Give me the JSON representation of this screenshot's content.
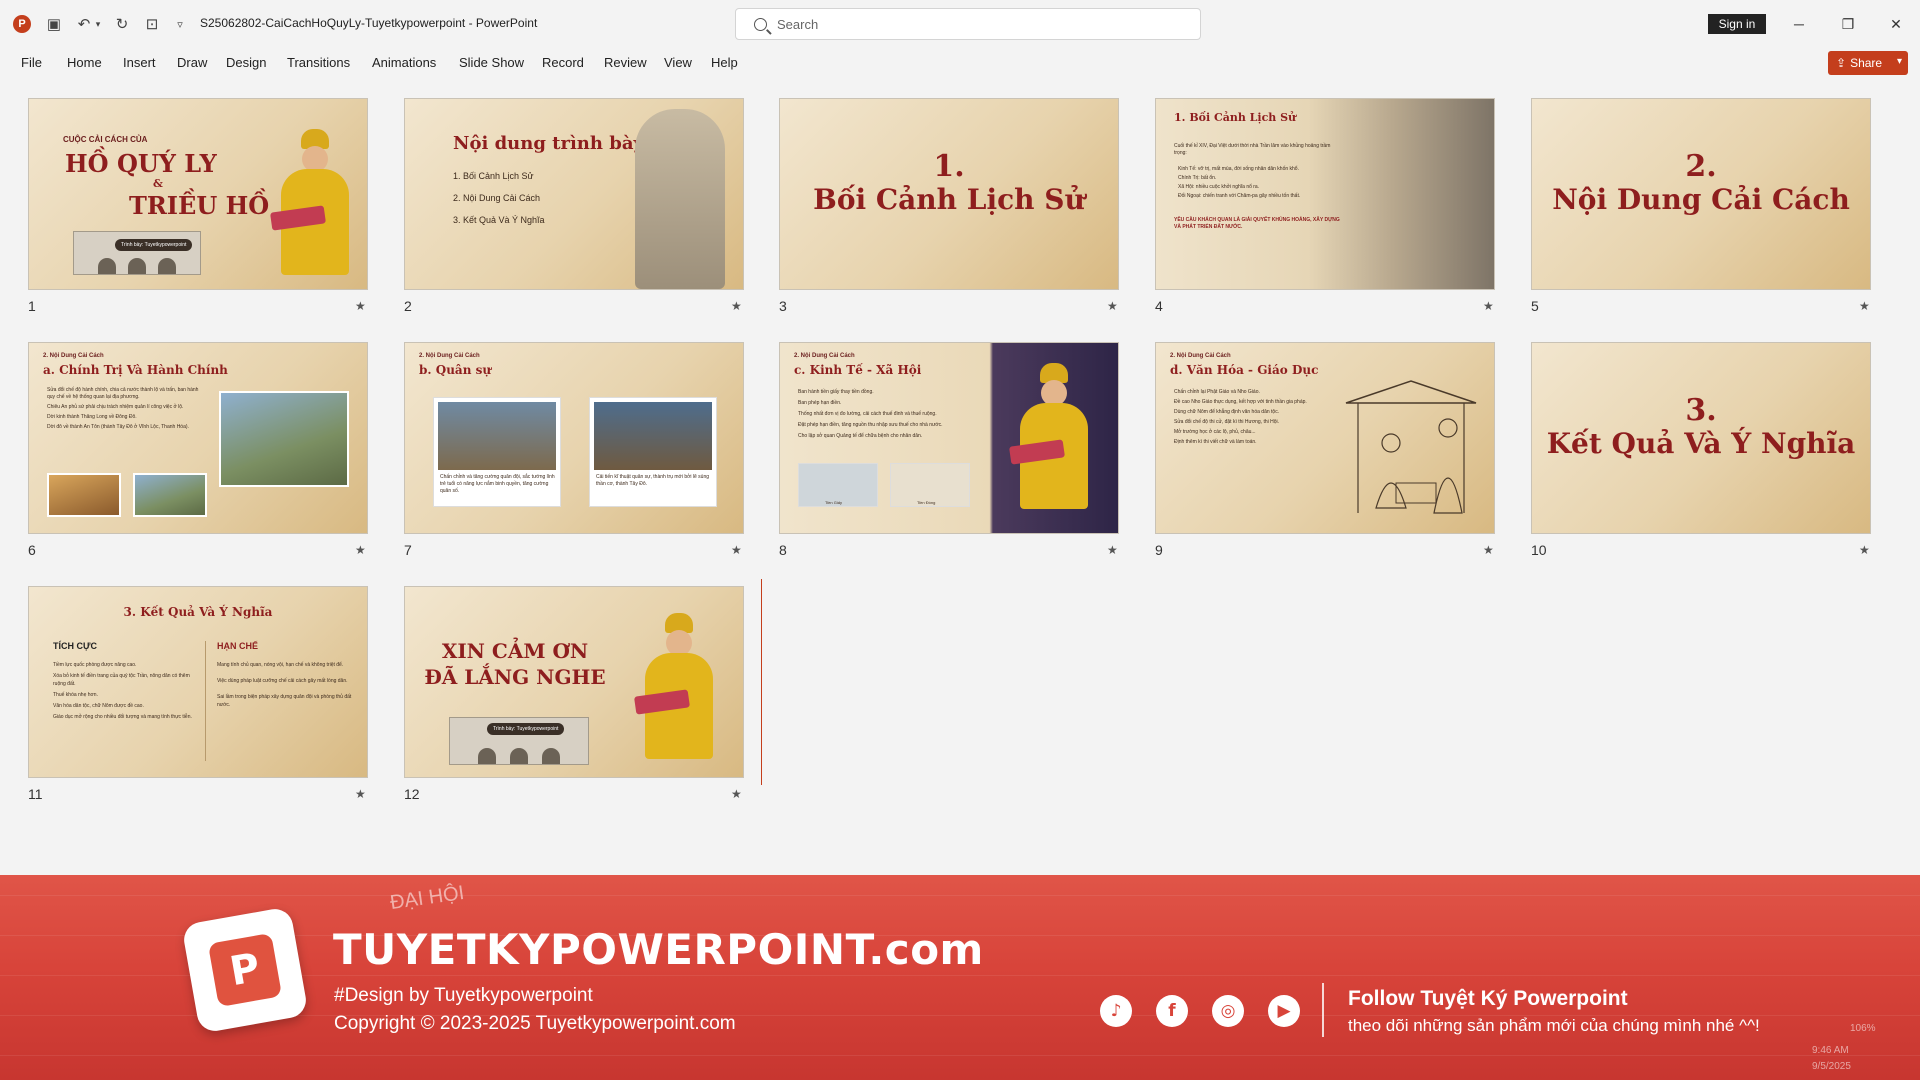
{
  "titlebar": {
    "doc_title": "S25062802-CaiCachHoQuyLy-Tuyetkypowerpoint  -  PowerPoint",
    "search_placeholder": "Search",
    "sign_in": "Sign in",
    "app_logo": "P"
  },
  "menu": [
    "File",
    "Home",
    "Insert",
    "Draw",
    "Design",
    "Transitions",
    "Animations",
    "Slide Show",
    "Record",
    "Review",
    "View",
    "Help"
  ],
  "share_label": "Share",
  "slides": [
    {
      "num": "1",
      "kicker": "CUỘC CẢI CÁCH CỦA",
      "title_a": "HỒ QUÝ LY",
      "amp": "&",
      "title_b": "TRIỀU HỒ",
      "tag": "Trình bày: Tuyetkypowerpoint"
    },
    {
      "num": "2",
      "title": "Nội dung trình bày",
      "items": [
        "1. Bối Cảnh Lịch Sử",
        "2. Nội Dung Cải Cách",
        "3. Kết Quả Và Ý Nghĩa"
      ]
    },
    {
      "num": "3",
      "line1": "1.",
      "line2": "Bối Cảnh Lịch Sử"
    },
    {
      "num": "4",
      "title": "1. Bối Cảnh Lịch Sử",
      "intro": "Cuối thế kỉ XIV, Đại Việt dưới thời nhà Trần lâm vào khủng hoảng trầm trọng:",
      "bullets": [
        "Kinh Tế: vỡ trị, mất mùa, đời sống nhân dân khốn khổ.",
        "Chính Trị: bất ổn.",
        "Xã Hội: nhiều cuộc khởi nghĩa nổ ra.",
        "Đối Ngoại: chiến tranh với Chăm-pa gây nhiều tốn thất."
      ],
      "note": "YÊU CẦU KHÁCH QUAN LÀ GIẢI QUYẾT KHỦNG HOẢNG, XÂY DỰNG VÀ PHÁT TRIỂN ĐẤT NƯỚC."
    },
    {
      "num": "5",
      "line1": "2.",
      "line2": "Nội Dung Cải Cách"
    },
    {
      "num": "6",
      "kicker": "2. Nội Dung Cải Cách",
      "title": "a. Chính Trị Và Hành Chính",
      "bullets": [
        "Sửa đổi chế độ hành chính, chia cả nước thành lộ và trấn, ban hành quy chế về hệ thống quan lại địa phương.",
        "Chiêu An phủ sứ phải chịu trách nhiệm quản lí công việc ở lộ.",
        "Dời kinh thành Thăng Long về Đông Đô.",
        "Dời đô về thành An Tôn (thành Tây Đô ở Vĩnh Lộc, Thanh Hóa)."
      ]
    },
    {
      "num": "7",
      "kicker": "2. Nội Dung Cải Cách",
      "title": "b. Quân sự",
      "cap1": "Chấn chỉnh và tăng cường quân đội, sắc tướng lính trẻ tuổi có năng lực nắm binh quyền, tăng cường quân số.",
      "cap2": "Cải tiến kĩ thuật quân sự, thành trụ mới bởi lẽ súng thần cơ, thành Tây Đô."
    },
    {
      "num": "8",
      "kicker": "2. Nội Dung Cải Cách",
      "title": "c. Kinh Tế - Xã Hội",
      "bullets": [
        "Ban hành tiền giấy thay tiền đồng.",
        "Ban phép hạn điền.",
        "Thống nhất đơn vị đo lường, cải cách thuế đinh và thuế ruộng.",
        "Đặt phép hạn điền, tăng nguồn thu nhập sưu thuế cho nhà nước.",
        "Cho lập sở quan Quảng tế để chữa bệnh cho nhân dân."
      ],
      "lbl1": "Tiền Giấy",
      "lbl2": "Tiền Đồng"
    },
    {
      "num": "9",
      "kicker": "2. Nội Dung Cải Cách",
      "title": "d. Văn Hóa - Giáo Dục",
      "bullets": [
        "Chấn chỉnh lại Phật Giáo và Nho Giáo.",
        "Đề cao Nho Giáo thực dụng, kết hợp với tinh thần gia pháp.",
        "Dùng chữ Nôm để khẳng định văn hóa dân tộc.",
        "Sửa đổi chế độ thi cử, đặt kì thi Hương, thi Hội.",
        "Mở trường học ở các lộ, phủ, châu...",
        "Định thêm kì thi viết chữ và làm toán."
      ]
    },
    {
      "num": "10",
      "line1": "3.",
      "line2": "Kết Quả Và Ý Nghĩa"
    },
    {
      "num": "11",
      "title": "3. Kết Quả Và Ý Nghĩa",
      "col1": "TÍCH CỰC",
      "col2": "HẠN CHẾ",
      "pos": [
        "Tiềm lực quốc phòng được nâng cao.",
        "Xóa bỏ kinh tế điền trang của quý tộc Trần, nông dân có thêm ruộng đất.",
        "Thuế khóa nhẹ hơn.",
        "Văn hóa dân tộc, chữ Nôm được đề cao.",
        "Giáo dục mở rộng cho nhiều đối tượng và mang tính thực tiễn."
      ],
      "neg": [
        "Mang tính chủ quan, nóng vội, hạn chế và không triệt để.",
        "Việc dùng pháp luật cưỡng chế cải cách gây mất lòng dân.",
        "Sai lầm trong biện pháp xây dựng quân đội và phòng thủ đất nước."
      ]
    },
    {
      "num": "12",
      "line1": "XIN CẢM ƠN",
      "line2": "ĐÃ LẮNG NGHE",
      "tag": "Trình bày: Tuyetkypowerpoint"
    }
  ],
  "banner": {
    "brand": "TUYETKYPOWERPOINT.com",
    "design_by": "#Design by Tuyetkypowerpoint",
    "copyright": "Copyright © 2023-2025 Tuyetkypowerpoint.com",
    "follow": "Follow Tuyệt Ký Powerpoint",
    "follow_sub": "theo dõi những sản phẩm mới của chúng mình nhé ^^!",
    "social_icons": [
      "tiktok-icon",
      "facebook-icon",
      "instagram-icon",
      "youtube-icon"
    ],
    "watermark_ghost": "ĐẠI HỘI",
    "zoom": "106%",
    "clock": "9:46 AM",
    "date": "9/5/2025",
    "colors": {
      "brand_red": "#d8443a",
      "ppt_orange": "#c43e1c",
      "slide_title": "#8e1e1e"
    }
  }
}
